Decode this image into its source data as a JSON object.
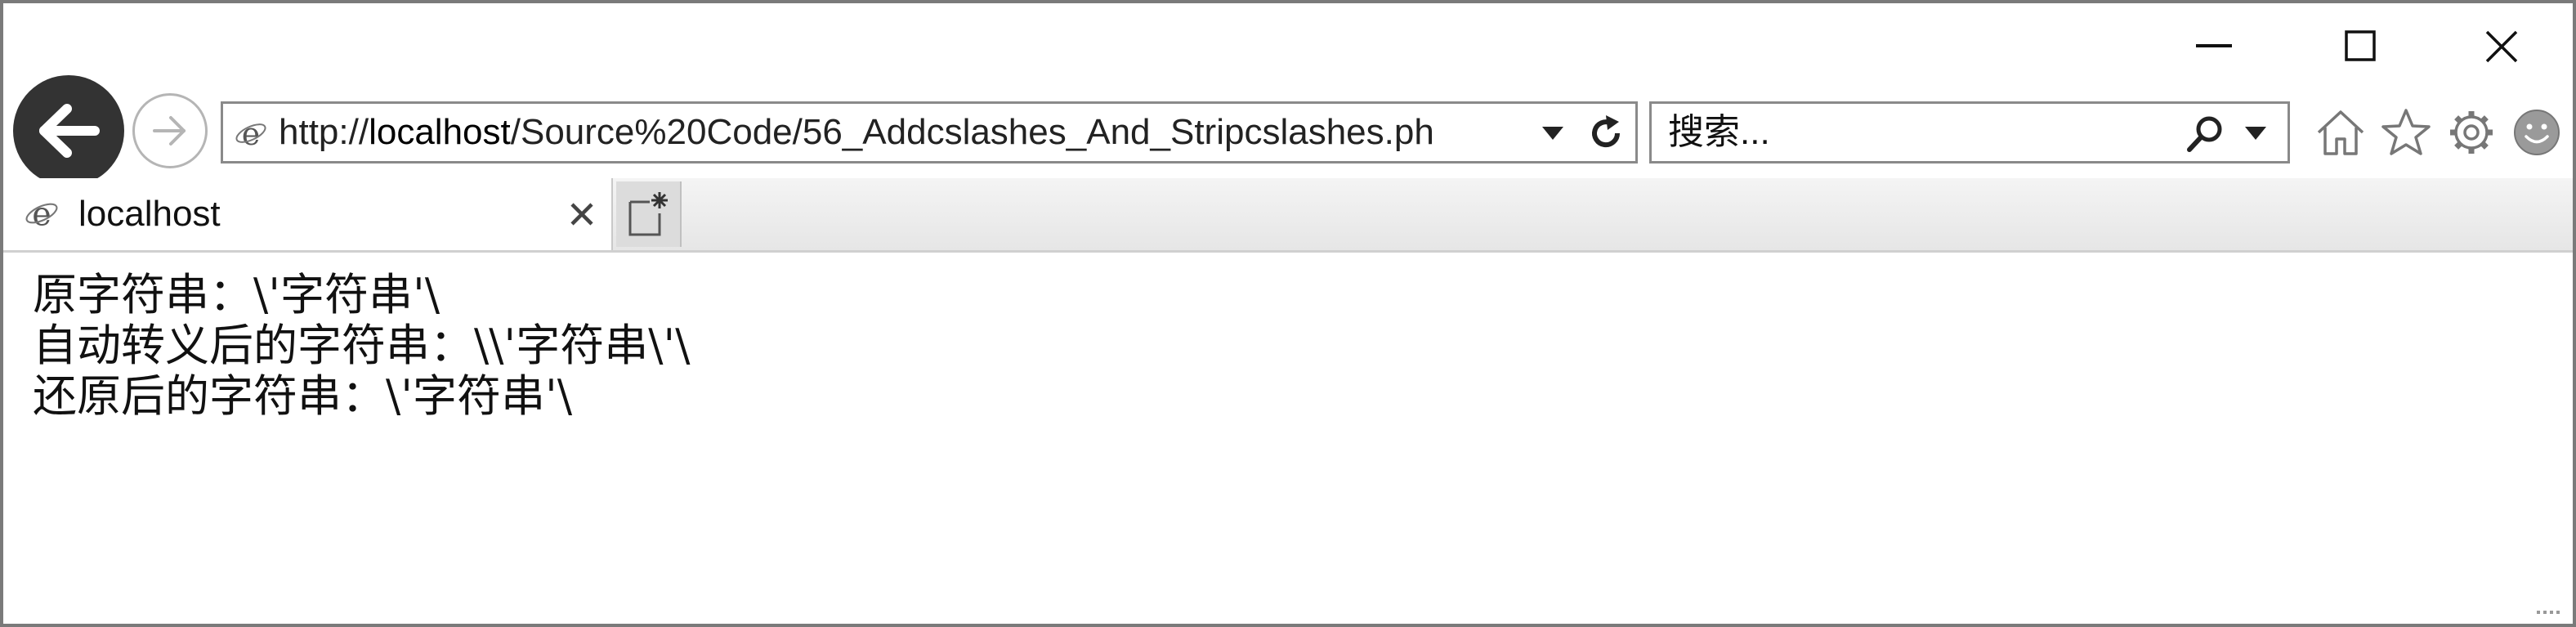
{
  "window": {
    "controls": {
      "minimize": "minimize",
      "maximize": "maximize",
      "close": "close"
    }
  },
  "navigation": {
    "back_icon": "back-arrow-icon",
    "forward_icon": "forward-arrow-icon"
  },
  "address_bar": {
    "url_prefix": "http://",
    "url_host": "localhost",
    "url_path": "/Source%20Code/56_Addcslashes_And_Stripcslashes.ph",
    "favicon": "ie-page-icon",
    "dropdown_icon": "chevron-down-icon",
    "refresh_icon": "refresh-icon"
  },
  "search": {
    "placeholder": "搜索...",
    "search_icon": "search-icon",
    "dropdown_icon": "chevron-down-icon"
  },
  "toolbar": {
    "icons": [
      "home-icon",
      "star-icon",
      "gear-icon",
      "smiley-icon"
    ]
  },
  "tabs": [
    {
      "title": "localhost",
      "favicon": "ie-page-icon",
      "close_icon": "close-icon"
    }
  ],
  "new_tab_icon": "new-tab-icon",
  "content": {
    "lines": [
      "原字符串：\\'字符串'\\",
      "自动转义后的字符串：\\\\'字符串\\'\\",
      "还原后的字符串：\\'字符串'\\"
    ]
  },
  "colors": {
    "frame_border": "#7a7a7a",
    "back_button": "#333333",
    "page_background": "#ffffff",
    "tab_strip": "#e6e6e6"
  }
}
